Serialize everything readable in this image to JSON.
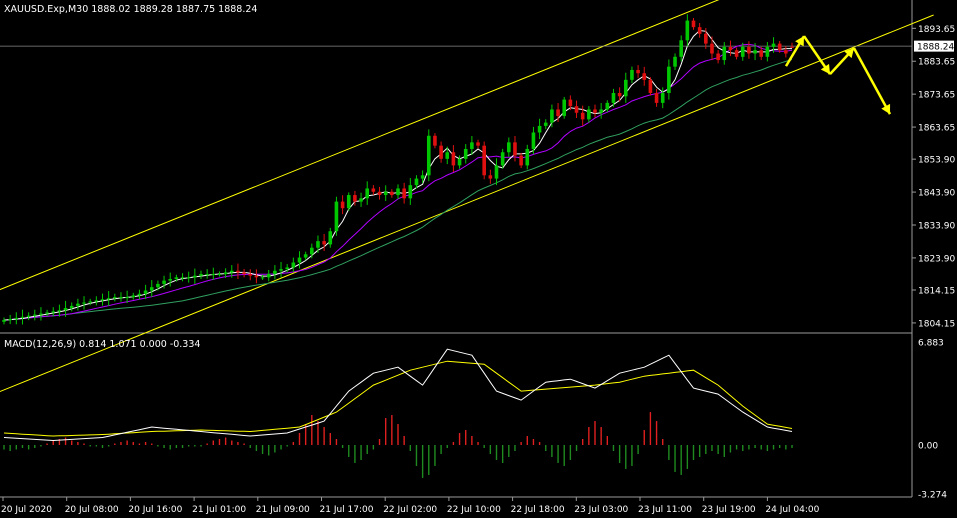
{
  "header": {
    "symbol_line": "XAUUSD.Exp,M30  1888.02 1889.28 1887.75 1888.24"
  },
  "macd_header": {
    "text": "MACD(12,26,9) 0.814 1.071 0.000 -0.334"
  },
  "price_axis": {
    "labels": [
      "1893.65",
      "1883.65",
      "1873.65",
      "1863.65",
      "1853.90",
      "1843.90",
      "1833.90",
      "1823.90",
      "1814.15",
      "1804.15"
    ],
    "last_price": "1888.24"
  },
  "macd_axis": {
    "labels": [
      "6.883",
      "0.00",
      "-3.274"
    ]
  },
  "time_axis": {
    "labels": [
      "20 Jul 2020",
      "20 Jul 08:00",
      "20 Jul 16:00",
      "21 Jul 01:00",
      "21 Jul 09:00",
      "21 Jul 17:00",
      "22 Jul 02:00",
      "22 Jul 10:00",
      "22 Jul 18:00",
      "23 Jul 03:00",
      "23 Jul 11:00",
      "23 Jul 19:00",
      "24 Jul 04:00"
    ]
  },
  "colors": {
    "background": "#000000",
    "bull_candle": "#00c800",
    "bear_candle": "#e01010",
    "channel": "#ffff00",
    "ma_fast": "#ffffff",
    "ma_mid": "#b000ff",
    "ma_slow": "#30a060",
    "macd_line": "#ffffff",
    "signal_line": "#ffff00",
    "hist_pos": "#e02020",
    "hist_neg": "#1f8a1f",
    "projection": "#ffff00",
    "grid_line": "#8a8a8a",
    "axis_text": "#ffffff"
  },
  "chart_data": [
    {
      "type": "line",
      "panel": "price",
      "symbol": "XAUUSD.Exp",
      "timeframe": "M30",
      "ohlc_last": {
        "open": 1888.02,
        "high": 1889.28,
        "low": 1887.75,
        "close": 1888.24
      },
      "y_range": [
        1802,
        1898
      ],
      "x_labels": [
        "20 Jul 2020",
        "20 Jul 08:00",
        "20 Jul 16:00",
        "21 Jul 01:00",
        "21 Jul 09:00",
        "21 Jul 17:00",
        "22 Jul 02:00",
        "22 Jul 10:00",
        "22 Jul 18:00",
        "23 Jul 03:00",
        "23 Jul 11:00",
        "23 Jul 19:00",
        "24 Jul 04:00"
      ],
      "close_path": [
        [
          0,
          1805
        ],
        [
          3,
          1806
        ],
        [
          6,
          1807
        ],
        [
          9,
          1808
        ],
        [
          12,
          1810
        ],
        [
          15,
          1811
        ],
        [
          18,
          1812
        ],
        [
          20,
          1812
        ],
        [
          22,
          1813
        ],
        [
          24,
          1815
        ],
        [
          26,
          1817
        ],
        [
          28,
          1818
        ],
        [
          30,
          1818
        ],
        [
          32,
          1819
        ],
        [
          35,
          1819
        ],
        [
          37,
          1820
        ],
        [
          39,
          1819
        ],
        [
          41,
          1818
        ],
        [
          42,
          1818
        ],
        [
          44,
          1820
        ],
        [
          46,
          1821
        ],
        [
          48,
          1824
        ],
        [
          49,
          1825
        ],
        [
          50,
          1827
        ],
        [
          51,
          1829
        ],
        [
          52,
          1828
        ],
        [
          53,
          1832
        ],
        [
          54,
          1841
        ],
        [
          55,
          1839
        ],
        [
          56,
          1843
        ],
        [
          57,
          1841
        ],
        [
          58,
          1842
        ],
        [
          59,
          1845
        ],
        [
          60,
          1844
        ],
        [
          61,
          1843
        ],
        [
          62,
          1844
        ],
        [
          63,
          1843
        ],
        [
          64,
          1845
        ],
        [
          65,
          1842
        ],
        [
          66,
          1846
        ],
        [
          67,
          1848
        ],
        [
          68,
          1849
        ],
        [
          69,
          1861
        ],
        [
          70,
          1858
        ],
        [
          71,
          1854
        ],
        [
          72,
          1856
        ],
        [
          73,
          1852
        ],
        [
          74,
          1854
        ],
        [
          75,
          1857
        ],
        [
          76,
          1859
        ],
        [
          77,
          1858
        ],
        [
          78,
          1849
        ],
        [
          79,
          1848
        ],
        [
          80,
          1852
        ],
        [
          81,
          1856
        ],
        [
          82,
          1859
        ],
        [
          83,
          1855
        ],
        [
          84,
          1852
        ],
        [
          85,
          1857
        ],
        [
          86,
          1862
        ],
        [
          87,
          1864
        ],
        [
          88,
          1865
        ],
        [
          89,
          1869
        ],
        [
          90,
          1867
        ],
        [
          91,
          1872
        ],
        [
          92,
          1870
        ],
        [
          93,
          1868
        ],
        [
          94,
          1866
        ],
        [
          95,
          1869
        ],
        [
          96,
          1868
        ],
        [
          97,
          1869
        ],
        [
          98,
          1871
        ],
        [
          99,
          1874
        ],
        [
          100,
          1873
        ],
        [
          101,
          1878
        ],
        [
          102,
          1881
        ],
        [
          103,
          1880
        ],
        [
          104,
          1878
        ],
        [
          105,
          1874
        ],
        [
          106,
          1871
        ],
        [
          107,
          1874
        ],
        [
          108,
          1882
        ],
        [
          109,
          1885
        ],
        [
          110,
          1890
        ],
        [
          111,
          1896
        ],
        [
          112,
          1894
        ],
        [
          113,
          1892
        ],
        [
          114,
          1889
        ],
        [
          115,
          1886
        ],
        [
          116,
          1884
        ],
        [
          117,
          1888
        ],
        [
          118,
          1887
        ],
        [
          119,
          1885
        ],
        [
          120,
          1888
        ],
        [
          121,
          1886
        ],
        [
          122,
          1887
        ],
        [
          123,
          1885
        ],
        [
          124,
          1888
        ],
        [
          125,
          1889
        ],
        [
          126,
          1887
        ],
        [
          127,
          1886
        ],
        [
          128,
          1888
        ]
      ],
      "bar_count": 129
    },
    {
      "type": "bar",
      "panel": "macd",
      "title": "MACD(12,26,9) 0.814 1.071 0.000 -0.334",
      "y_range": [
        -3.274,
        6.883
      ],
      "macd_path": [
        [
          0,
          0.5
        ],
        [
          8,
          0.3
        ],
        [
          16,
          0.5
        ],
        [
          24,
          1.2
        ],
        [
          32,
          0.9
        ],
        [
          40,
          0.6
        ],
        [
          46,
          0.8
        ],
        [
          52,
          1.6
        ],
        [
          56,
          3.6
        ],
        [
          60,
          4.8
        ],
        [
          64,
          5.2
        ],
        [
          68,
          4.0
        ],
        [
          72,
          6.4
        ],
        [
          76,
          6.0
        ],
        [
          80,
          3.6
        ],
        [
          84,
          3.0
        ],
        [
          88,
          4.2
        ],
        [
          92,
          4.4
        ],
        [
          96,
          3.8
        ],
        [
          100,
          4.8
        ],
        [
          104,
          5.2
        ],
        [
          108,
          6.0
        ],
        [
          112,
          3.8
        ],
        [
          116,
          3.4
        ],
        [
          120,
          2.2
        ],
        [
          124,
          1.2
        ],
        [
          128,
          0.9
        ]
      ],
      "signal_path": [
        [
          0,
          0.8
        ],
        [
          8,
          0.6
        ],
        [
          16,
          0.7
        ],
        [
          24,
          0.9
        ],
        [
          32,
          1.0
        ],
        [
          40,
          0.9
        ],
        [
          48,
          1.2
        ],
        [
          54,
          2.2
        ],
        [
          60,
          4.0
        ],
        [
          66,
          5.0
        ],
        [
          72,
          5.6
        ],
        [
          78,
          5.4
        ],
        [
          84,
          3.6
        ],
        [
          90,
          3.8
        ],
        [
          96,
          4.0
        ],
        [
          100,
          4.2
        ],
        [
          104,
          4.6
        ],
        [
          108,
          4.8
        ],
        [
          112,
          5.0
        ],
        [
          116,
          4.0
        ],
        [
          120,
          2.6
        ],
        [
          124,
          1.4
        ],
        [
          128,
          1.1
        ]
      ],
      "histogram": [
        -0.3,
        -0.4,
        -0.3,
        -0.2,
        -0.3,
        -0.2,
        -0.1,
        0.1,
        0.3,
        0.4,
        0.5,
        0.3,
        0.2,
        0.1,
        -0.1,
        -0.1,
        -0.2,
        -0.1,
        0.1,
        0.2,
        0.3,
        0.2,
        0.1,
        0.2,
        0.1,
        -0.1,
        -0.2,
        -0.3,
        -0.2,
        -0.2,
        -0.1,
        -0.1,
        -0.1,
        0.1,
        0.3,
        0.4,
        0.5,
        0.3,
        0.2,
        0.1,
        -0.2,
        -0.4,
        -0.6,
        -0.7,
        -0.5,
        -0.3,
        -0.1,
        0.2,
        0.8,
        1.4,
        2.0,
        1.6,
        1.2,
        0.8,
        0.4,
        -0.2,
        -0.8,
        -1.2,
        -1.0,
        -0.6,
        -0.3,
        0.4,
        1.8,
        2.0,
        1.4,
        0.6,
        -0.4,
        -1.4,
        -2.2,
        -2.0,
        -1.4,
        -0.6,
        -0.2,
        0.2,
        0.8,
        1.0,
        0.6,
        0.2,
        -0.2,
        -0.6,
        -1.0,
        -1.2,
        -0.8,
        -0.4,
        0.2,
        0.6,
        0.4,
        0.2,
        -0.4,
        -0.8,
        -1.2,
        -1.4,
        -1.0,
        -0.4,
        0.4,
        1.2,
        1.6,
        1.2,
        0.6,
        -0.4,
        -1.2,
        -1.6,
        -1.4,
        -0.6,
        1.0,
        2.2,
        1.6,
        0.4,
        -1.0,
        -1.8,
        -2.0,
        -1.6,
        -1.0,
        -0.8,
        -0.6,
        -0.4,
        -0.6,
        -0.8,
        -0.5,
        -0.3,
        -0.4,
        -0.3,
        -0.2,
        -0.3,
        -0.4,
        -0.3,
        -0.2,
        -0.3,
        -0.2
      ]
    }
  ]
}
